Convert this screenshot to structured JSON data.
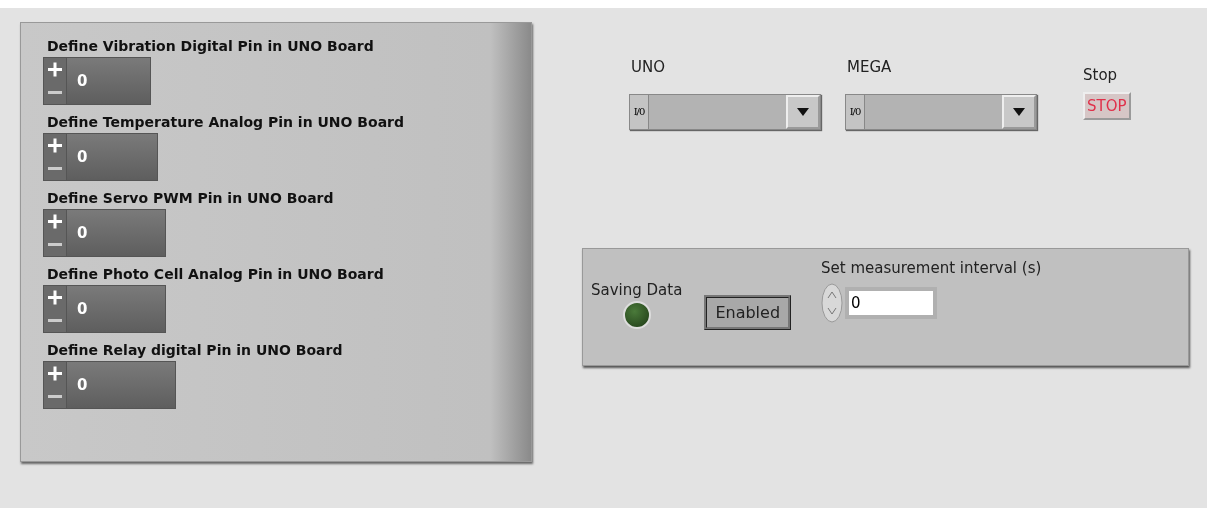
{
  "pin_panel": {
    "fields": [
      {
        "label": "Define Vibration Digital Pin in UNO Board",
        "value": "0"
      },
      {
        "label": "Define Temperature Analog Pin in UNO Board",
        "value": "0"
      },
      {
        "label": "Define Servo PWM Pin in UNO Board",
        "value": "0"
      },
      {
        "label": "Define Photo Cell Analog Pin in UNO Board",
        "value": "0"
      },
      {
        "label": "Define Relay digital Pin in UNO Board",
        "value": "0"
      }
    ]
  },
  "ports": [
    {
      "label": "UNO",
      "io_label": "I/0"
    },
    {
      "label": "MEGA",
      "io_label": "I/0"
    }
  ],
  "stop": {
    "label": "Stop",
    "button": "STOP"
  },
  "saving_panel": {
    "led_label": "Saving Data",
    "led_on": false,
    "button": "Enabled",
    "interval_label": "Set measurement interval (s)",
    "interval_value": "0"
  }
}
